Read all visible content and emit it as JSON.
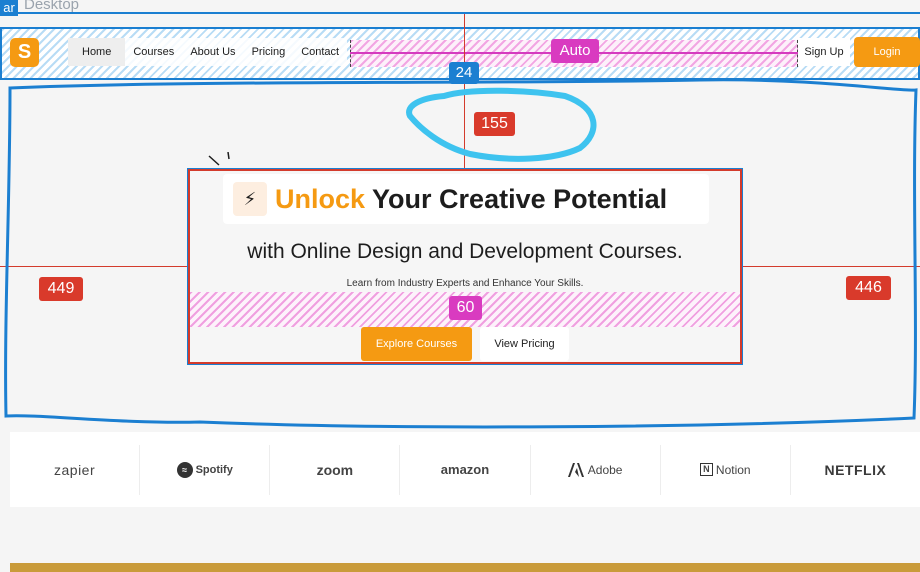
{
  "frame": {
    "tag": "ar",
    "title": "Desktop"
  },
  "navbar": {
    "logo": "S",
    "links": [
      "Home",
      "Courses",
      "About Us",
      "Pricing",
      "Contact"
    ],
    "auto_label": "Auto",
    "signup": "Sign Up",
    "login": "Login",
    "gap_label": "24"
  },
  "measurements": {
    "top": "155",
    "left": "449",
    "right": "446",
    "inner_gap": "60"
  },
  "hero": {
    "headline_accent": "Unlock",
    "headline_rest": " Your Creative Potential",
    "subheadline": "with Online Design and Development Courses.",
    "tagline": "Learn from Industry Experts and Enhance Your Skills.",
    "primary_button": "Explore Courses",
    "secondary_button": "View Pricing"
  },
  "logos": [
    "zapier",
    "Spotify",
    "zoom",
    "amazon",
    "Adobe",
    "Notion",
    "NETFLIX"
  ],
  "colors": {
    "accent": "#f59a12",
    "annotation_blue": "#1b7fd1",
    "measure_red": "#d93a2b",
    "spacing_pink": "#d93bc0",
    "scribble_cyan": "#3ec3ef"
  }
}
